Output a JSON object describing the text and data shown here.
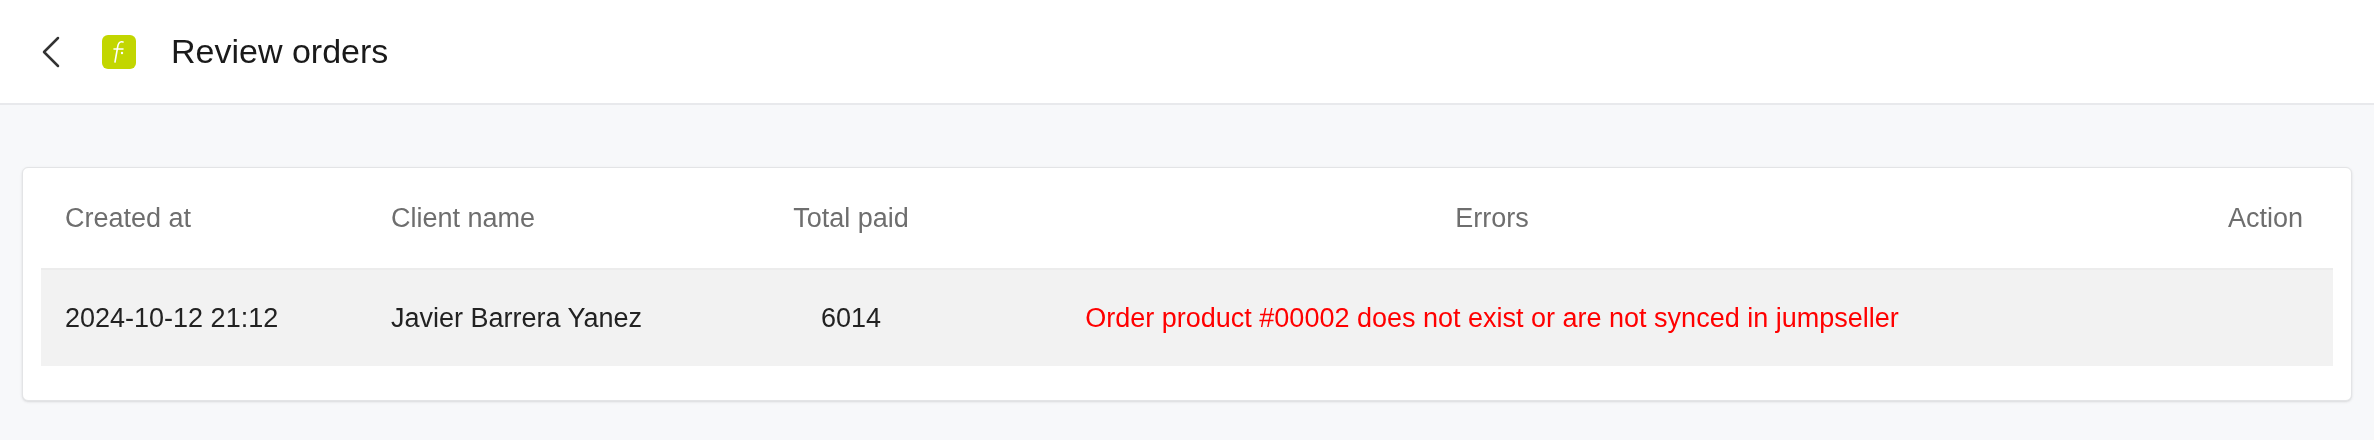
{
  "header": {
    "title": "Review orders"
  },
  "table": {
    "columns": [
      "Created at",
      "Client name",
      "Total paid",
      "Errors",
      "Action"
    ],
    "rows": [
      {
        "cells": [
          "2024-10-12 21:12",
          "Javier Barrera Yanez",
          "6014",
          "Order product #00002 does not exist or are not synced in jumpseller",
          ""
        ]
      }
    ]
  }
}
